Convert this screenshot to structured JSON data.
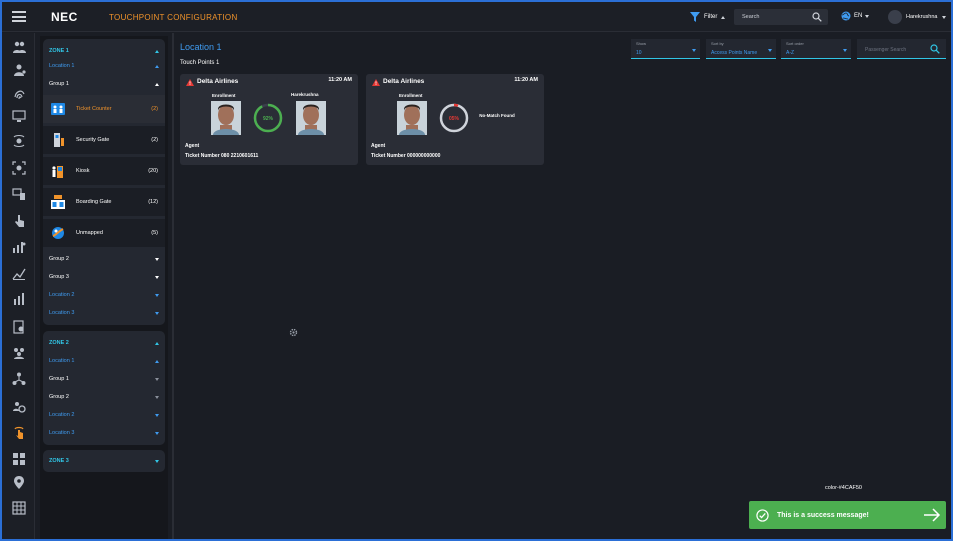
{
  "header": {
    "logo": "NEC",
    "title": "TOUCHPOINT CONFIGURATION",
    "filter_label": "Filter",
    "search_placeholder": "Search",
    "language": "EN",
    "username": "Harekrushna"
  },
  "sidebar_icons": [
    "users-icon",
    "group-icon",
    "fingerprint-icon",
    "monitor-icon",
    "biometric-icon",
    "scan-face-icon",
    "devices-icon",
    "touch-icon",
    "bar-chart-icon",
    "line-chart-icon",
    "analytics-icon",
    "report-icon",
    "people-icon",
    "network-icon",
    "settings-group-icon",
    "touchpoint-icon",
    "grid-icon",
    "location-pin-icon",
    "table-icon"
  ],
  "zones": {
    "zone1": {
      "label": "ZONE 1",
      "location1": "Location 1",
      "group1": "Group 1",
      "touchpoints": [
        {
          "label": "Ticket Counter",
          "count": "(2)",
          "active": true
        },
        {
          "label": "Security Gate",
          "count": "(2)"
        },
        {
          "label": "Kiosk",
          "count": "(20)"
        },
        {
          "label": "Boarding Gate",
          "count": "(12)"
        },
        {
          "label": "Unmapped",
          "count": "(5)"
        }
      ],
      "group2": "Group 2",
      "group3": "Group 3",
      "location2": "Location 2",
      "location3": "Location 3"
    },
    "zone2": {
      "label": "ZONE 2",
      "location1": "Location 1",
      "group1": "Group 1",
      "group2": "Group 2",
      "location2": "Location 2",
      "location3": "Location 3"
    },
    "zone3": {
      "label": "ZONE 3"
    }
  },
  "main": {
    "location_title": "Location 1",
    "touch_points": "Touch Points 1",
    "show": {
      "label": "Show",
      "value": "10"
    },
    "sort_by": {
      "label": "Sort by",
      "value": "Access Points Name"
    },
    "sort_order": {
      "label": "Sort order",
      "value": "A-Z"
    },
    "passenger_search_placeholder": "Passenger Search",
    "cards": [
      {
        "airline": "Delta Airlines",
        "time": "11:20 AM",
        "enrollment": "Enrollment",
        "match_name": "Harekrushna",
        "score": "92%",
        "score_fraction": 0.92,
        "score_color": "#4CAF50",
        "agent": "Agent",
        "ticket": "Ticket Number 080 2210601611"
      },
      {
        "airline": "Delta Airlines",
        "time": "11:20 AM",
        "enrollment": "Enrollment",
        "no_match": "No-Match Found",
        "score": "05%",
        "score_fraction": 0.05,
        "score_color": "#e53935",
        "agent": "Agent",
        "ticket": "Ticket Number 000000000000"
      }
    ]
  },
  "toast": {
    "color_label": "color-#4CAF50",
    "message": "This is a success message!",
    "color": "#4CAF50"
  }
}
